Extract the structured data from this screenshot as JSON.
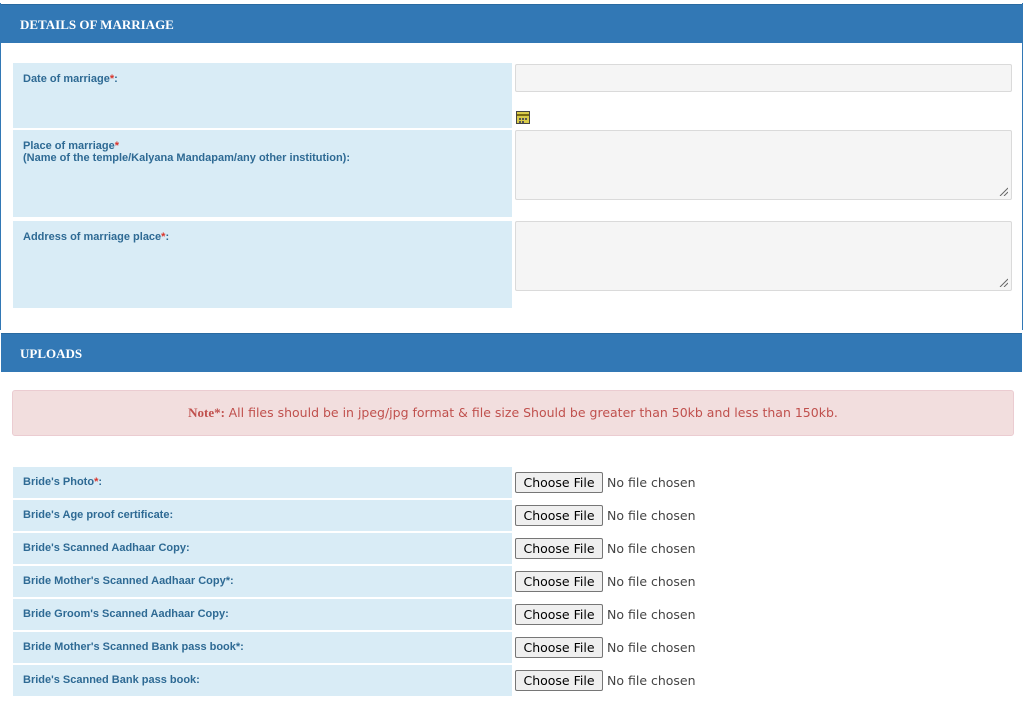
{
  "marriage": {
    "header": "DETAILS OF MARRIAGE",
    "date_label": "Date of marriage",
    "date_req": "*",
    "date_suffix": ":",
    "date_value": "",
    "place_label": "Place of marriage",
    "place_req": "*",
    "place_sub": "(Name of the temple/Kalyana Mandapam/any other institution):",
    "place_value": "",
    "address_label": "Address of marriage place",
    "address_req": "*",
    "address_suffix": ":",
    "address_value": "",
    "calendar_icon": "calendar-icon"
  },
  "uploads": {
    "header": "UPLOADS",
    "note_prefix": "Note*:",
    "note_text": "All files should be in jpeg/jpg format & file size Should be greater than 50kb and less than 150kb.",
    "button_label": "Choose File",
    "status_text": "No file chosen",
    "items": [
      {
        "label": "Bride's Photo",
        "req": "*",
        "suffix": ":"
      },
      {
        "label": "Bride's Age proof certificate:",
        "req": "",
        "suffix": ""
      },
      {
        "label": "Bride's Scanned Aadhaar Copy:",
        "req": "",
        "suffix": ""
      },
      {
        "label": "Bride Mother's Scanned Aadhaar Copy*:",
        "req": "",
        "suffix": ""
      },
      {
        "label": "Bride Groom's Scanned Aadhaar Copy:",
        "req": "",
        "suffix": ""
      },
      {
        "label": "Bride Mother's Scanned Bank pass book*:",
        "req": "",
        "suffix": ""
      },
      {
        "label": "Bride's Scanned Bank pass book:",
        "req": "",
        "suffix": ""
      }
    ]
  },
  "colors": {
    "header_bg": "#3278b5",
    "label_bg": "#d9ecf6",
    "label_text": "#2e6a94",
    "required": "#d9342b",
    "note_bg": "#f2dede",
    "note_text": "#c0504d"
  }
}
